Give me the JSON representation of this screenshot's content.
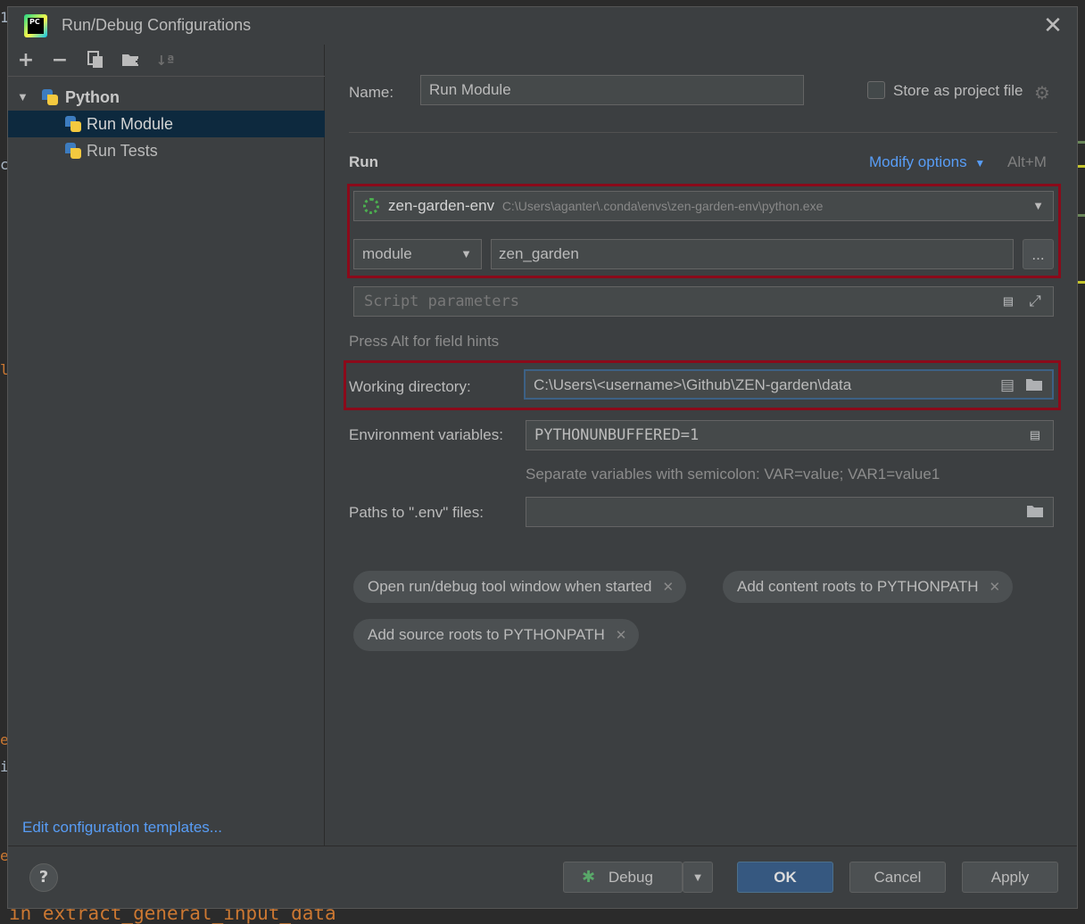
{
  "dialog": {
    "title": "Run/Debug Configurations",
    "logo_text": "PC"
  },
  "left_toolbar": {
    "icons": [
      "add-icon",
      "remove-icon",
      "copy-icon",
      "new-folder-icon",
      "sort-icon"
    ]
  },
  "tree": {
    "group_label": "Python",
    "items": [
      {
        "label": "Run Module",
        "selected": true
      },
      {
        "label": "Run Tests",
        "selected": false
      }
    ]
  },
  "edit_templates_link": "Edit configuration templates...",
  "name_row": {
    "label": "Name:",
    "value": "Run Module",
    "store_label": "Store as project file"
  },
  "run_section": {
    "heading": "Run",
    "modify_options": "Modify options",
    "modify_shortcut": "Alt+M",
    "interpreter_name": "zen-garden-env",
    "interpreter_path": "C:\\Users\\aganter\\.conda\\envs\\zen-garden-env\\python.exe",
    "target_type": "module",
    "target_value": "zen_garden",
    "browse_label": "...",
    "script_params_placeholder": "Script parameters",
    "hint": "Press Alt for field hints"
  },
  "working_directory": {
    "label": "Working directory:",
    "value": "C:\\Users\\<username>\\Github\\ZEN-garden\\data"
  },
  "env_vars": {
    "label": "Environment variables:",
    "value": "PYTHONUNBUFFERED=1",
    "hint": "Separate variables with semicolon: VAR=value; VAR1=value1"
  },
  "env_files": {
    "label": "Paths to \".env\" files:",
    "value": ""
  },
  "chips": [
    "Open run/debug tool window when started",
    "Add content roots to PYTHONPATH",
    "Add source roots to PYTHONPATH"
  ],
  "buttons": {
    "help": "?",
    "debug": "Debug",
    "ok": "OK",
    "cancel": "Cancel",
    "apply": "Apply"
  },
  "background": {
    "bottom_code": "in extract_general_input_data"
  },
  "colors": {
    "accent_link": "#589df6",
    "highlight_box": "#8b0a1a",
    "selection": "#0d293e",
    "ok_button": "#365880"
  }
}
